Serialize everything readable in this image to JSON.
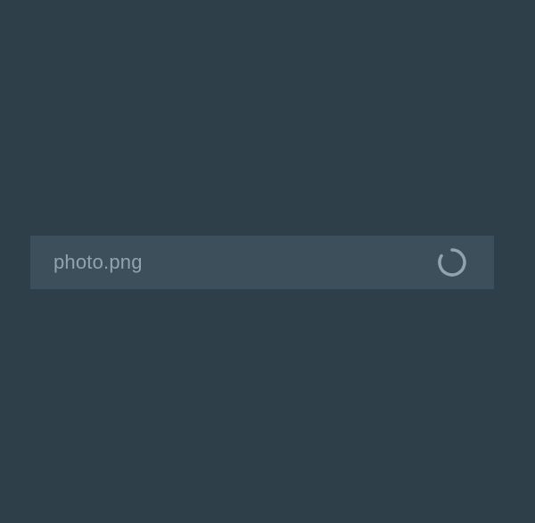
{
  "upload": {
    "file_name": "photo.png",
    "status_icon": "loading-spinner-icon"
  },
  "colors": {
    "background": "#2e3f4a",
    "item_background": "#3d4f5a",
    "file_name_text": "#93a3ae",
    "spinner": "#93a3ae"
  }
}
